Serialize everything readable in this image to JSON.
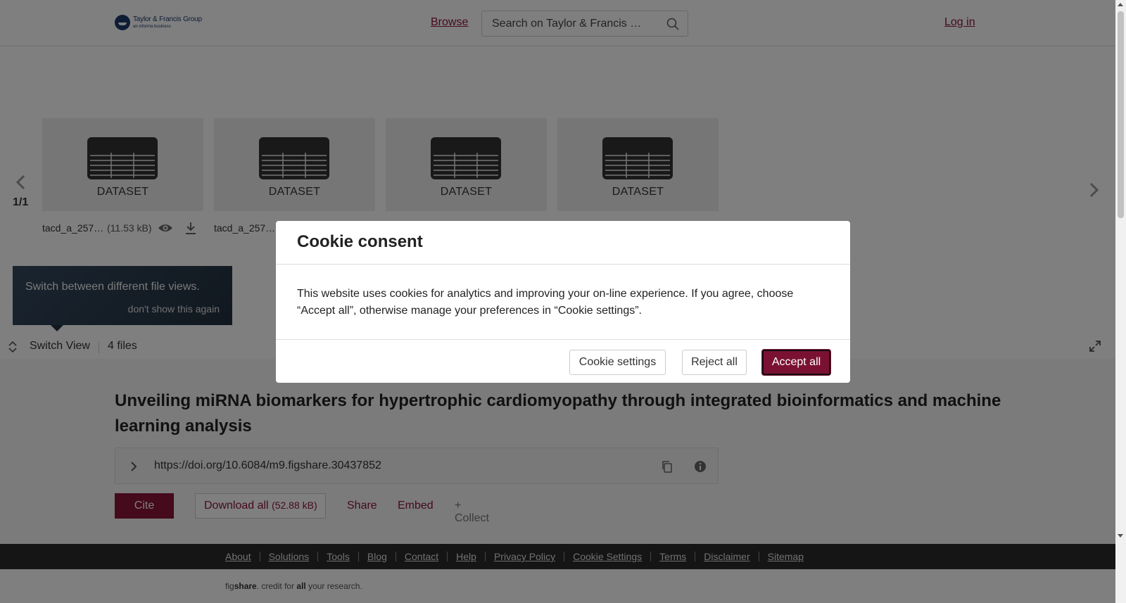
{
  "header": {
    "logo_name": "Taylor & Francis Group",
    "logo_sub": "an informa business",
    "browse_label": "Browse",
    "search_placeholder": "Search on Taylor & Francis …",
    "login_label": "Log in"
  },
  "carousel": {
    "page_counter": "1/1",
    "tiles": [
      {
        "label": "DATASET",
        "file_name": "tacd_a_257…",
        "file_size": "(11.53 kB)"
      },
      {
        "label": "DATASET",
        "file_name": "tacd_a_257…"
      },
      {
        "label": "DATASET"
      },
      {
        "label": "DATASET"
      }
    ]
  },
  "tooltip": {
    "text": "Switch between different file views.",
    "dismiss": "don't show this again"
  },
  "viewbar": {
    "switch_label": "Switch View",
    "files_count": "4 files"
  },
  "item": {
    "title": "Unveiling miRNA biomarkers for hypertrophic cardiomyopathy through integrated bioinformatics and machine learning analysis",
    "doi": "https://doi.org/10.6084/m9.figshare.30437852",
    "cite_label": "Cite",
    "download_label": "Download all",
    "download_size": "(52.88 kB)",
    "share_label": "Share",
    "embed_label": "Embed",
    "collect_label": "+ Collect"
  },
  "footer": {
    "links": [
      "About",
      "Solutions",
      "Tools",
      "Blog",
      "Contact",
      "Help",
      "Privacy Policy",
      "Cookie Settings",
      "Terms",
      "Disclaimer",
      "Sitemap"
    ],
    "credit_pre": "fig",
    "credit_brand": "share",
    "credit_mid": ". credit for ",
    "credit_all": "all",
    "credit_post": " your research."
  },
  "cookie_modal": {
    "title": "Cookie consent",
    "body": "This website uses cookies for analytics and improving your on-line experience. If you agree, choose “Accept all”, otherwise manage your preferences in “Cookie settings”.",
    "settings_label": "Cookie settings",
    "reject_label": "Reject all",
    "accept_label": "Accept all"
  },
  "colors": {
    "accent": "#8a1538",
    "overlay": "rgba(0,0,0,0.5)",
    "footer_bg": "#2b2b2b"
  }
}
